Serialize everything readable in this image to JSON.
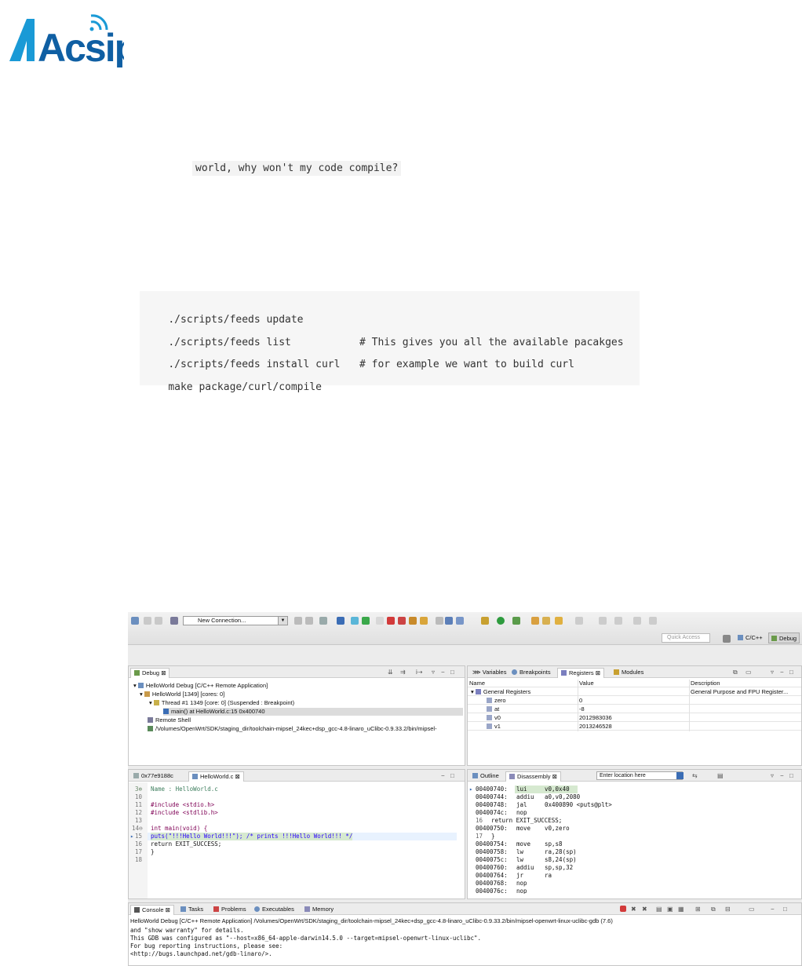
{
  "logo": {
    "text": "Acsip",
    "color": "#1f8fc9"
  },
  "inline_code": "world, why won't my code compile?",
  "code_block": [
    {
      "cmd": "./scripts/feeds update",
      "comment": ""
    },
    {
      "cmd": "./scripts/feeds list",
      "comment": "# This gives you all the available pacakges"
    },
    {
      "cmd": "./scripts/feeds install curl",
      "comment": "# for example we want to build curl"
    },
    {
      "cmd": "make package/curl/compile",
      "comment": ""
    }
  ],
  "ide": {
    "toolbar": {
      "connection": "New Connection...",
      "quick_access": "Quick Access",
      "perspective_cc": "C/C++",
      "perspective_debug": "Debug"
    },
    "debug_view": {
      "tab": "Debug",
      "items": [
        "HelloWorld Debug [C/C++ Remote Application]",
        "HelloWorld [1349] [cores: 0]",
        "Thread #1 1349 [core: 0] (Suspended : Breakpoint)",
        "main() at HelloWorld.c:15 0x400740",
        "Remote Shell",
        "/Volumes/OpenWrt/SDK/staging_dir/toolchain-mipsel_24kec+dsp_gcc-4.8-linaro_uClibc-0.9.33.2/bin/mipsel-"
      ]
    },
    "registers_view": {
      "tabs": [
        "Variables",
        "Breakpoints",
        "Registers",
        "Modules"
      ],
      "columns": [
        "Name",
        "Value",
        "Description"
      ],
      "rows": [
        {
          "name": "General Registers",
          "value": "",
          "desc": "General Purpose and FPU Register..."
        },
        {
          "name": "zero",
          "value": "0",
          "desc": ""
        },
        {
          "name": "at",
          "value": "-8",
          "desc": ""
        },
        {
          "name": "v0",
          "value": "2012983036",
          "desc": ""
        },
        {
          "name": "v1",
          "value": "2013246528",
          "desc": ""
        }
      ]
    },
    "editor": {
      "tabs": [
        "0x77e9188c",
        "HelloWorld.c"
      ],
      "lines": [
        {
          "num": "3⊕",
          "text": " Name        : HelloWorld.c"
        },
        {
          "num": "10",
          "text": ""
        },
        {
          "num": "11",
          "text": "#include <stdio.h>"
        },
        {
          "num": "12",
          "text": "#include <stdlib.h>"
        },
        {
          "num": "13",
          "text": ""
        },
        {
          "num": "14⊖",
          "text": "int main(void) {"
        },
        {
          "num": "15",
          "text": "    puts(\"!!!Hello World!!!\"); /* prints !!!Hello World!!! */"
        },
        {
          "num": "16",
          "text": "    return EXIT_SUCCESS;"
        },
        {
          "num": "17",
          "text": "}"
        },
        {
          "num": "18",
          "text": ""
        }
      ]
    },
    "disassembly": {
      "tabs": [
        "Outline",
        "Disassembly"
      ],
      "location_placeholder": "Enter location here",
      "lines": [
        {
          "addr": "00400740:",
          "op": "lui",
          "args": "v0,0x40"
        },
        {
          "addr": "00400744:",
          "op": "addiu",
          "args": "a0,v0,2080"
        },
        {
          "addr": "00400748:",
          "op": "jal",
          "args": "0x400890 <puts@plt>"
        },
        {
          "addr": "0040074c:",
          "op": "nop",
          "args": ""
        },
        {
          "addr": "16",
          "op": "",
          "args": "        return EXIT_SUCCESS;"
        },
        {
          "addr": "00400750:",
          "op": "move",
          "args": "v0,zero"
        },
        {
          "addr": "17",
          "op": "",
          "args": "    }"
        },
        {
          "addr": "00400754:",
          "op": "move",
          "args": "sp,s8"
        },
        {
          "addr": "00400758:",
          "op": "lw",
          "args": "ra,28(sp)"
        },
        {
          "addr": "0040075c:",
          "op": "lw",
          "args": "s8,24(sp)"
        },
        {
          "addr": "00400760:",
          "op": "addiu",
          "args": "sp,sp,32"
        },
        {
          "addr": "00400764:",
          "op": "jr",
          "args": "ra"
        },
        {
          "addr": "00400768:",
          "op": "nop",
          "args": ""
        },
        {
          "addr": "0040076c:",
          "op": "nop",
          "args": ""
        }
      ]
    },
    "console": {
      "tabs": [
        "Console",
        "Tasks",
        "Problems",
        "Executables",
        "Memory"
      ],
      "header": "HelloWorld Debug [C/C++ Remote Application] /Volumes/OpenWrt/SDK/staging_dir/toolchain-mipsel_24kec+dsp_gcc-4.8-linaro_uClibc-0.9.33.2/bin/mipsel-openwrt-linux-uclibc-gdb (7.6)",
      "lines": [
        "and \"show warranty\" for details.",
        "This GDB was configured as \"--host=x86_64-apple-darwin14.5.0 --target=mipsel-openwrt-linux-uclibc\".",
        "For bug reporting instructions, please see:",
        "<http://bugs.launchpad.net/gdb-linaro/>."
      ]
    }
  }
}
